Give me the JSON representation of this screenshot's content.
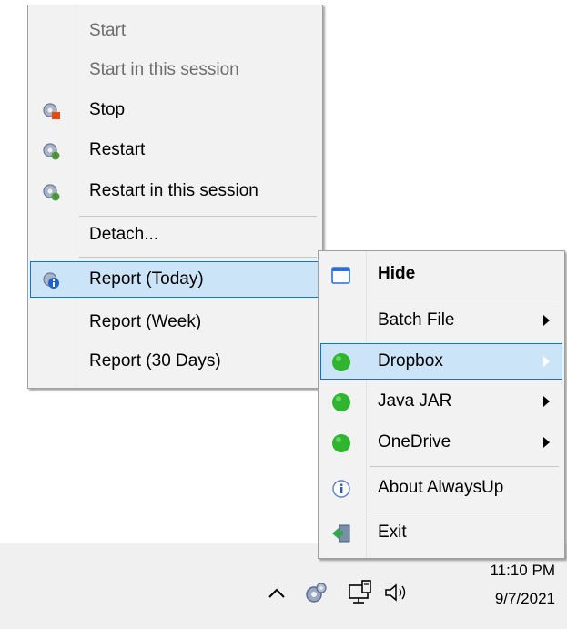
{
  "context_menu": {
    "items": [
      {
        "label": "Start",
        "enabled": false
      },
      {
        "label": "Start in this session",
        "enabled": false
      },
      {
        "label": "Stop",
        "icon": "gear-stop-icon"
      },
      {
        "label": "Restart",
        "icon": "gear-restart-icon"
      },
      {
        "label": "Restart in this session",
        "icon": "gear-restart-session-icon"
      },
      {
        "label": "Detach..."
      },
      {
        "label": "Report (Today)",
        "icon": "gear-info-icon",
        "highlighted": true
      },
      {
        "label": "Report (Week)"
      },
      {
        "label": "Report (30 Days)"
      }
    ]
  },
  "tray_menu": {
    "items": [
      {
        "label": "Hide",
        "icon": "window-icon",
        "bold": true
      },
      {
        "label": "Batch File",
        "submenu": true
      },
      {
        "label": "Dropbox",
        "icon": "status-green-icon",
        "submenu": true,
        "highlighted": true
      },
      {
        "label": "Java JAR",
        "icon": "status-green-icon",
        "submenu": true
      },
      {
        "label": "OneDrive",
        "icon": "status-green-icon",
        "submenu": true
      },
      {
        "label": "About AlwaysUp",
        "icon": "info-icon"
      },
      {
        "label": "Exit",
        "icon": "exit-icon"
      }
    ]
  },
  "taskbar": {
    "time": "11:10 PM",
    "date": "9/7/2021",
    "tray_icons": [
      "chevron-up-icon",
      "alwaysup-gear-icon",
      "network-icon",
      "volume-icon"
    ]
  },
  "colors": {
    "menu_bg": "#f2f2f2",
    "highlight_bg": "#cce4f7",
    "highlight_border": "#0078d7",
    "status_green": "#2fb52f"
  }
}
